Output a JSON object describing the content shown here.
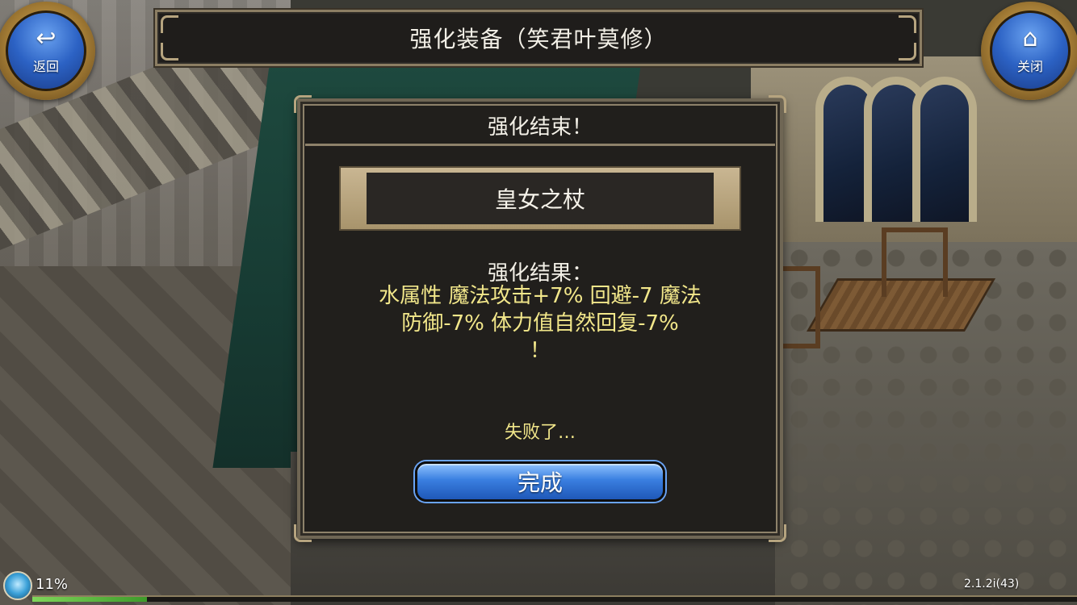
{
  "header": {
    "title": "强化装备（笑君叶莫修）",
    "back_label": "返回",
    "back_icon": "↩",
    "close_label": "关闭",
    "close_icon": "⌂"
  },
  "dialog": {
    "title": "强化结束！",
    "item_name": "皇女之杖",
    "result_title": "强化结果：",
    "result_lines": [
      "水属性 魔法攻击+7% 回避-7 魔法",
      "防御-7% 体力值自然回复-7%",
      "！"
    ],
    "fail_text": "失败了…",
    "done_label": "完成"
  },
  "hud": {
    "progress_text": "11%",
    "progress_value": 0.11,
    "version": "2.1.2i(43)"
  },
  "colors": {
    "accent_blue": "#2c62c4",
    "result_yellow": "#f2e78a",
    "frame_gold": "#c9a45a"
  }
}
